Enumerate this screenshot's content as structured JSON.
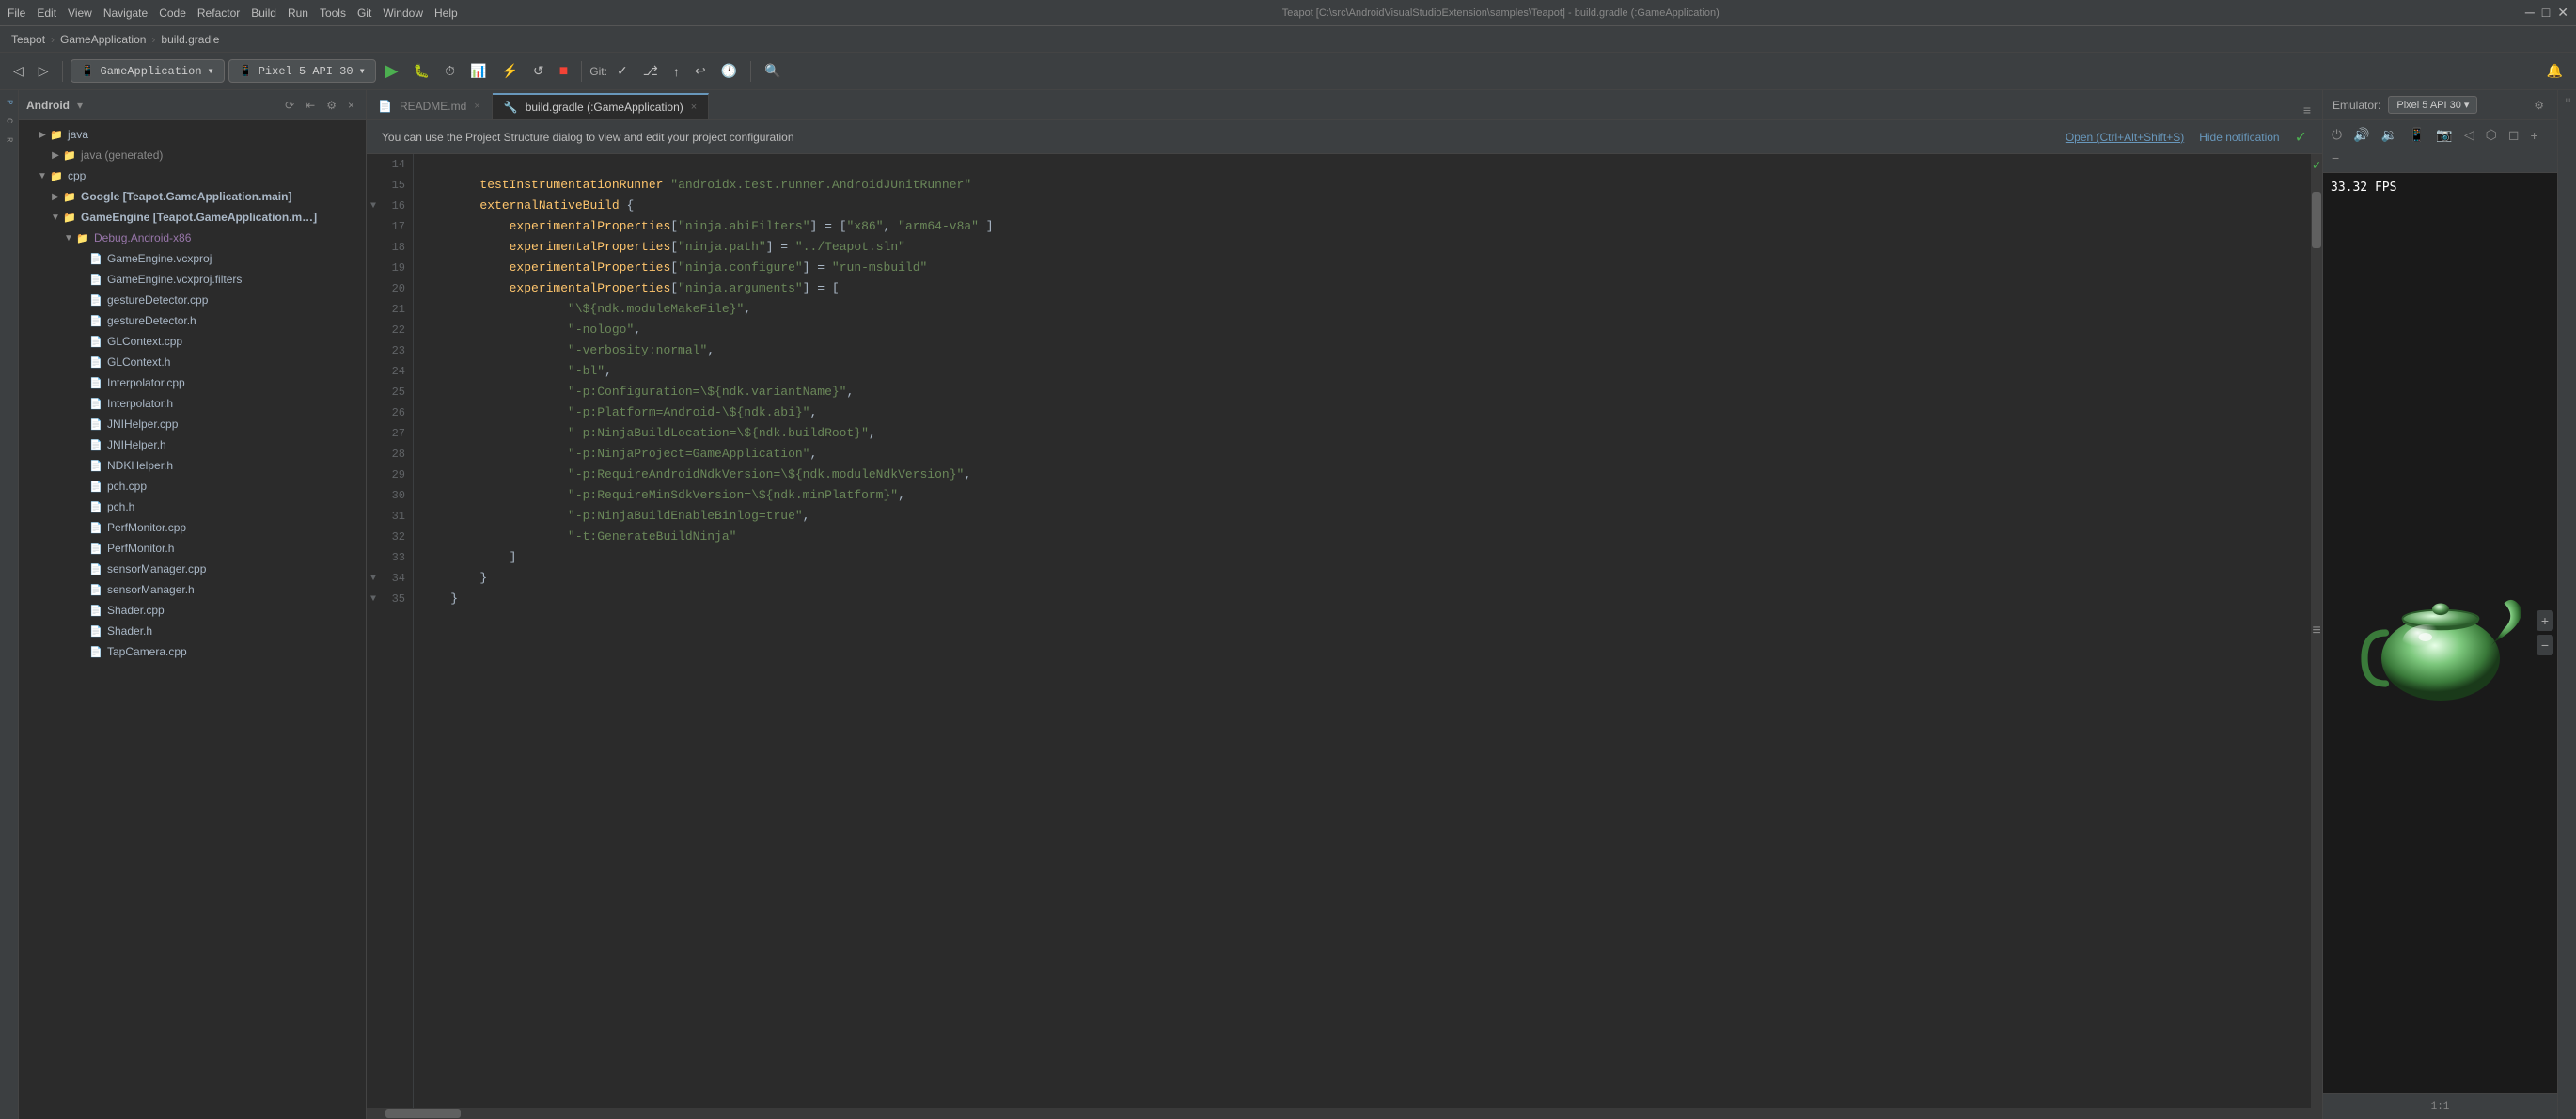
{
  "titleBar": {
    "appName": "Teapot",
    "menus": [
      "File",
      "Edit",
      "View",
      "Navigate",
      "Code",
      "Refactor",
      "Build",
      "Run",
      "Tools",
      "Git",
      "Window",
      "Help"
    ],
    "windowTitle": "Teapot [C:\\src\\AndroidVisualStudioExtension\\samples\\Teapot] - build.gradle (:GameApplication)",
    "minimizeIcon": "─",
    "maximizeIcon": "□",
    "closeIcon": "✕"
  },
  "breadcrumb": {
    "items": [
      "Teapot",
      "GameApplication",
      "build.gradle"
    ]
  },
  "toolbar": {
    "runConfig": "GameApplication",
    "device": "Pixel 5 API 30",
    "gitLabel": "Git:",
    "searchIcon": "🔍"
  },
  "projectPanel": {
    "title": "Android",
    "treeItems": [
      {
        "label": "java",
        "type": "folder",
        "indent": 1,
        "expanded": true
      },
      {
        "label": "java (generated)",
        "type": "folder",
        "indent": 2,
        "expanded": false
      },
      {
        "label": "cpp",
        "type": "folder",
        "indent": 1,
        "expanded": true
      },
      {
        "label": "Google [Teapot.GameApplication.main]",
        "type": "folder",
        "indent": 2,
        "expanded": false
      },
      {
        "label": "GameEngine [Teapot.GameApplication.m...]",
        "type": "folder",
        "indent": 2,
        "expanded": true
      },
      {
        "label": "Debug.Android-x86",
        "type": "folder",
        "indent": 3,
        "expanded": true
      },
      {
        "label": "GameEngine.vcxproj",
        "type": "vcxproj",
        "indent": 4
      },
      {
        "label": "GameEngine.vcxproj.filters",
        "type": "vcxproj",
        "indent": 4
      },
      {
        "label": "gestureDetector.cpp",
        "type": "cpp",
        "indent": 4
      },
      {
        "label": "gestureDetector.h",
        "type": "h",
        "indent": 4
      },
      {
        "label": "GLContext.cpp",
        "type": "cpp",
        "indent": 4
      },
      {
        "label": "GLContext.h",
        "type": "h",
        "indent": 4
      },
      {
        "label": "Interpolator.cpp",
        "type": "cpp",
        "indent": 4
      },
      {
        "label": "Interpolator.h",
        "type": "h",
        "indent": 4
      },
      {
        "label": "JNIHelper.cpp",
        "type": "cpp",
        "indent": 4
      },
      {
        "label": "JNIHelper.h",
        "type": "h",
        "indent": 4
      },
      {
        "label": "NDKHelper.h",
        "type": "h",
        "indent": 4
      },
      {
        "label": "pch.cpp",
        "type": "cpp",
        "indent": 4
      },
      {
        "label": "pch.h",
        "type": "h",
        "indent": 4
      },
      {
        "label": "PerfMonitor.cpp",
        "type": "cpp",
        "indent": 4
      },
      {
        "label": "PerfMonitor.h",
        "type": "h",
        "indent": 4
      },
      {
        "label": "sensorManager.cpp",
        "type": "cpp",
        "indent": 4
      },
      {
        "label": "sensorManager.h",
        "type": "h",
        "indent": 4
      },
      {
        "label": "Shader.cpp",
        "type": "cpp",
        "indent": 4
      },
      {
        "label": "Shader.h",
        "type": "h",
        "indent": 4
      },
      {
        "label": "TapCamera.cpp",
        "type": "cpp",
        "indent": 4
      }
    ]
  },
  "tabs": [
    {
      "label": "README.md",
      "active": false
    },
    {
      "label": "build.gradle (:GameApplication)",
      "active": true
    }
  ],
  "notification": {
    "text": "You can use the Project Structure dialog to view and edit your project configuration",
    "openLink": "Open (Ctrl+Alt+Shift+S)",
    "hideLink": "Hide notification"
  },
  "codeEditor": {
    "startLine": 14,
    "lines": [
      {
        "num": 14,
        "content": ""
      },
      {
        "num": 15,
        "content": "        testInstrumentationRunner \"androidx.test.runner.AndroidJUnitRunner\""
      },
      {
        "num": 16,
        "content": "        externalNativeBuild {"
      },
      {
        "num": 17,
        "content": "            experimentalProperties[\"ninja.abiFilters\"] = [\"x86\", \"arm64-v8a\" ]"
      },
      {
        "num": 18,
        "content": "            experimentalProperties[\"ninja.path\"] = \"../Teapot.sln\""
      },
      {
        "num": 19,
        "content": "            experimentalProperties[\"ninja.configure\"] = \"run-msbuild\""
      },
      {
        "num": 20,
        "content": "            experimentalProperties[\"ninja.arguments\"] = ["
      },
      {
        "num": 21,
        "content": "                    \"\\${ndk.moduleMakeFile}\","
      },
      {
        "num": 22,
        "content": "                    \"-nologo\","
      },
      {
        "num": 23,
        "content": "                    \"-verbosity:normal\","
      },
      {
        "num": 24,
        "content": "                    \"-bl\","
      },
      {
        "num": 25,
        "content": "                    \"-p:Configuration=\\${ndk.variantName}\","
      },
      {
        "num": 26,
        "content": "                    \"-p:Platform=Android-\\${ndk.abi}\","
      },
      {
        "num": 27,
        "content": "                    \"-p:NinjaBuildLocation=\\${ndk.buildRoot}\","
      },
      {
        "num": 28,
        "content": "                    \"-p:NinjaProject=GameApplication\","
      },
      {
        "num": 29,
        "content": "                    \"-p:RequireAndroidNdkVersion=\\${ndk.moduleNdkVersion}\","
      },
      {
        "num": 30,
        "content": "                    \"-p:RequireMinSdkVersion=\\${ndk.minPlatform}\","
      },
      {
        "num": 31,
        "content": "                    \"-p:NinjaBuildEnableBinlog=true\","
      },
      {
        "num": 32,
        "content": "                    \"-t:GenerateBuildNinja\""
      },
      {
        "num": 33,
        "content": "            ]"
      },
      {
        "num": 34,
        "content": "        }"
      },
      {
        "num": 35,
        "content": "    }"
      }
    ]
  },
  "emulator": {
    "headerLabel": "Emulator:",
    "deviceName": "Pixel 5 API 30",
    "fps": "33.32 FPS",
    "scaleLabel": "1:1"
  }
}
